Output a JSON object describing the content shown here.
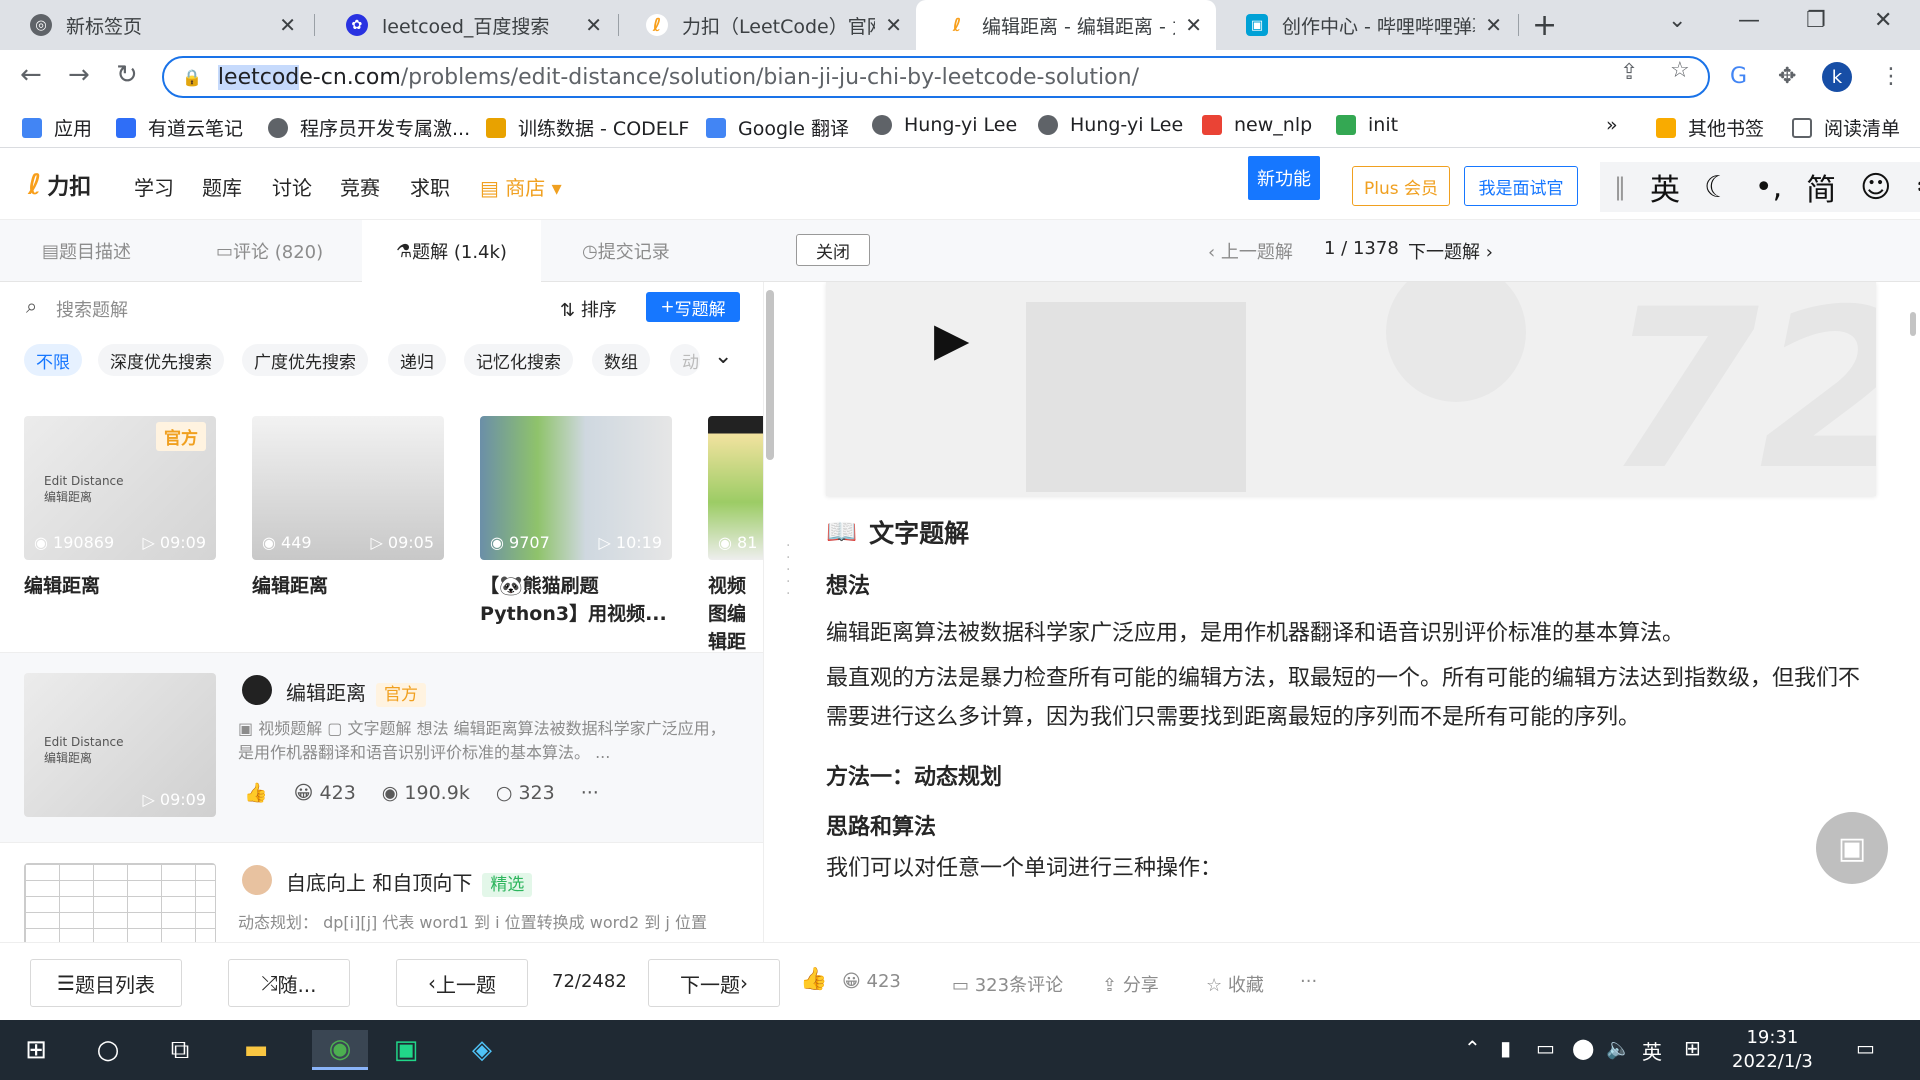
{
  "browser": {
    "tabs": [
      {
        "title": "新标签页",
        "favicon": "globe-icon",
        "color": "#5f6368"
      },
      {
        "title": "leetcoed_百度搜索",
        "favicon": "baidu-icon",
        "color": "#2932e1"
      },
      {
        "title": "力扣（LeetCode）官网 -",
        "favicon": "leetcode-icon",
        "color": "#f89f1b"
      },
      {
        "title": "编辑距离 - 编辑距离 - 力",
        "favicon": "leetcode-icon",
        "color": "#f89f1b"
      },
      {
        "title": "创作中心 - 哔哩哔哩弹幕",
        "favicon": "bilibili-icon",
        "color": "#00a1d6"
      }
    ],
    "url_highlight": "leetcod",
    "url_host": "e-cn.com",
    "url_path": "/problems/edit-distance/solution/bian-ji-ju-chi-by-leetcode-solution/",
    "profile_initial": "k",
    "bookmarks": [
      {
        "label": "应用",
        "color": "#4285f4"
      },
      {
        "label": "有道云笔记",
        "color": "#2f6ef7"
      },
      {
        "label": "程序员开发专属激...",
        "color": "#5f6368"
      },
      {
        "label": "训练数据 - CODELF",
        "color": "#e8a200"
      },
      {
        "label": "Google 翻译",
        "color": "#4285f4"
      },
      {
        "label": "Hung-yi Lee",
        "color": "#5f6368"
      },
      {
        "label": "Hung-yi Lee",
        "color": "#5f6368"
      },
      {
        "label": "new_nlp",
        "color": "#ea4335"
      },
      {
        "label": "init",
        "color": "#34a853"
      }
    ],
    "bookmarks_more": "»",
    "other_bookmarks": "其他书签",
    "reading_list": "阅读清单"
  },
  "header": {
    "logo": "力扣",
    "nav": [
      "学习",
      "题库",
      "讨论",
      "竞赛",
      "求职"
    ],
    "shop": "商店",
    "new_feature": "新功能",
    "plus": "Plus 会员",
    "interviewer": "我是面试官",
    "tools": [
      "英",
      "简"
    ]
  },
  "tabs": {
    "description": "题目描述",
    "comments": "评论 (820)",
    "solutions": "题解 (1.4k)",
    "submissions": "提交记录",
    "close": "关闭",
    "prev": "上一题解",
    "page": "1 / 1378",
    "next": "下一题解"
  },
  "left": {
    "search_placeholder": "搜索题解",
    "sort": "排序",
    "write": "写题解",
    "tags": [
      "不限",
      "深度优先搜索",
      "广度优先搜索",
      "递归",
      "记忆化搜索",
      "数组",
      "动"
    ],
    "videos": [
      {
        "views": "190869",
        "duration": "09:09",
        "title": "编辑距离",
        "badge": "官方"
      },
      {
        "views": "449",
        "duration": "09:05",
        "title": "编辑距离",
        "badge": ""
      },
      {
        "views": "9707",
        "duration": "10:19",
        "title": "【🐼熊猫刷题Python3】用视频...",
        "badge": ""
      },
      {
        "views": "81",
        "duration": "",
        "title": "视频图编辑距",
        "badge": ""
      }
    ],
    "solutions": [
      {
        "title": "编辑距离",
        "badge": "官方",
        "badge_color": "#f0a020",
        "badge_bg": "#fff3e0",
        "summary": "▣ 视频题解 ▢ 文字题解 想法 编辑距离算法被数据科学家广泛应用，是用作机器翻译和语音识别评价标准的基本算法。 ...",
        "likes": "423",
        "views": "190.9k",
        "comments": "323",
        "duration": "09:09"
      },
      {
        "title": "自底向上 和自顶向下",
        "badge": "精选",
        "badge_color": "#2db55d",
        "badge_bg": "#e3f7e9",
        "summary": "动态规划： dp[i][j] 代表 word1 到 i 位置转换成 word2 到 j 位置"
      }
    ]
  },
  "right": {
    "video_watermark": "72",
    "section_title": "文字题解",
    "h_idea": "想法",
    "p1": "编辑距离算法被数据科学家广泛应用，是用作机器翻译和语音识别评价标准的基本算法。",
    "p2": "最直观的方法是暴力检查所有可能的编辑方法，取最短的一个。所有可能的编辑方法达到指数级，但我们不需要进行这么多计算，因为我们只需要找到距离最短的序列而不是所有可能的序列。",
    "h_method": "方法一：动态规划",
    "h_algo": "思路和算法",
    "p3": "我们可以对任意一个单词进行三种操作："
  },
  "bottom": {
    "problem_list": "题目列表",
    "random": "随...",
    "prev": "上一题",
    "progress": "72/2482",
    "next": "下一题",
    "likes": "423",
    "comments": "323条评论",
    "share": "分享",
    "favorite": "收藏",
    "more": "···"
  },
  "taskbar": {
    "ime": "英",
    "time": "19:31",
    "date": "2022/1/3"
  }
}
